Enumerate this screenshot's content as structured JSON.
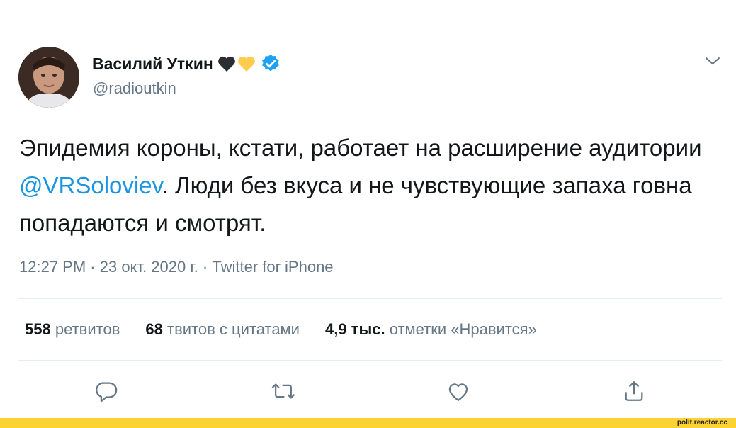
{
  "user": {
    "name": "Василий Уткин",
    "handle": "@radioutkin",
    "heart_colors": [
      "#292f33",
      "#ffcc4d"
    ],
    "verified_color": "#1da1f2"
  },
  "tweet": {
    "text_before": "Эпидемия короны, кстати, работает на расширение аудитории ",
    "mention": "@VRSoloviev",
    "text_after": ". Люди без вкуса и не чувствующие запаха говна попадаются и смотрят.",
    "time": "12:27 PM",
    "sep1": " · ",
    "date": "23 окт. 2020 г.",
    "sep2": " · ",
    "source": "Twitter for iPhone"
  },
  "stats": {
    "retweets_count": "558",
    "retweets_label": " ретвитов",
    "quotes_count": "68",
    "quotes_label": " твитов с цитатами",
    "likes_count": "4,9 тыс.",
    "likes_label": " отметки «Нравится»"
  },
  "actions": {
    "icons": [
      "reply-icon",
      "retweet-icon",
      "like-icon",
      "share-icon"
    ]
  },
  "footer": {
    "watermark": "polit.reactor.cc",
    "bar_color": "#fdd334"
  }
}
